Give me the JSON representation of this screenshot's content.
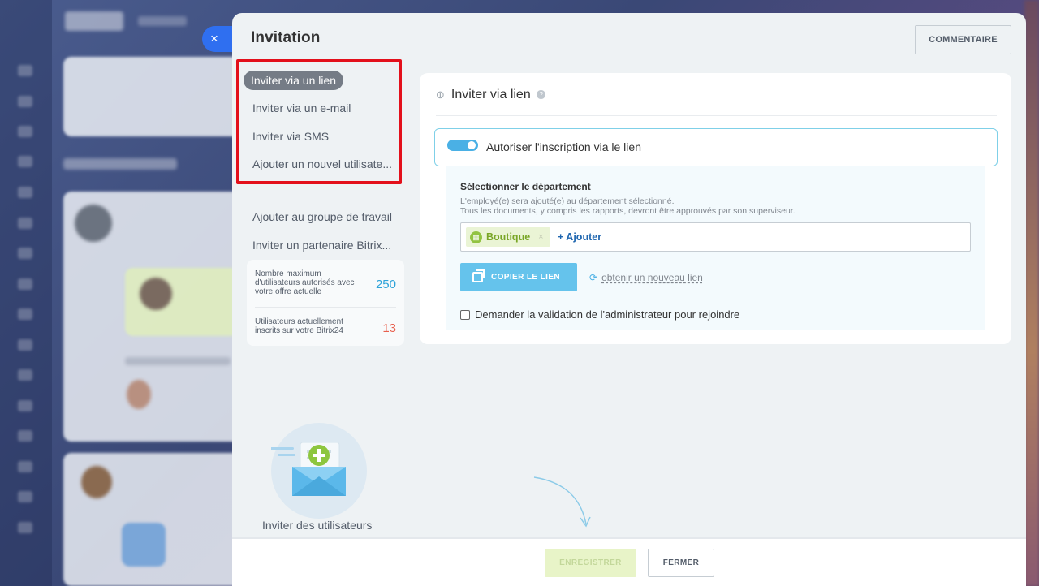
{
  "dialog": {
    "title": "Invitation",
    "comment_button": "COMMENTAIRE",
    "close_glyph": "×"
  },
  "menu": {
    "items": [
      {
        "label": "Inviter via un lien",
        "active": true
      },
      {
        "label": "Inviter via un e-mail"
      },
      {
        "label": "Inviter via SMS"
      },
      {
        "label": "Ajouter un nouvel utilisate..."
      },
      {
        "label": "Ajouter au groupe de travail"
      },
      {
        "label": "Inviter un partenaire Bitrix..."
      }
    ]
  },
  "stats": {
    "max_users_label": "Nombre maximum d'utilisateurs autorisés avec votre offre actuelle",
    "max_users_value": "250",
    "current_users_label": "Utilisateurs actuellement inscrits sur votre Bitrix24",
    "current_users_value": "13"
  },
  "illustration": {
    "caption": "Inviter des utilisateurs"
  },
  "link_section": {
    "heading": "Inviter via lien",
    "help_glyph": "?",
    "toggle_label": "Autoriser l'inscription via le lien",
    "department_title": "Sélectionner le département",
    "department_desc_line1": "L'employé(e) sera ajouté(e) au département sélectionné.",
    "department_desc_line2": "Tous les documents, y compris les rapports, devront être approuvés par son superviseur.",
    "department_chip": "Boutique",
    "chip_remove": "×",
    "add_link": "+ Ajouter",
    "copy_button": "COPIER LE LIEN",
    "regen_link": "obtenir un nouveau lien",
    "approval_checkbox": "Demander la validation de l'administrateur pour rejoindre"
  },
  "footer": {
    "save_button": "ENREGISTRER",
    "close_button": "FERMER"
  },
  "colors": {
    "accent": "#2f6ff0",
    "toggle_on": "#4ab0e5",
    "highlight_box": "#e3101b",
    "stat_max": "#2fa3d9",
    "stat_current": "#e85f4d"
  },
  "icons": {
    "link": "link-icon",
    "help": "help-icon",
    "department": "building-icon",
    "copy": "copy-icon",
    "refresh": "refresh-icon",
    "envelope": "envelope-plus-icon"
  }
}
